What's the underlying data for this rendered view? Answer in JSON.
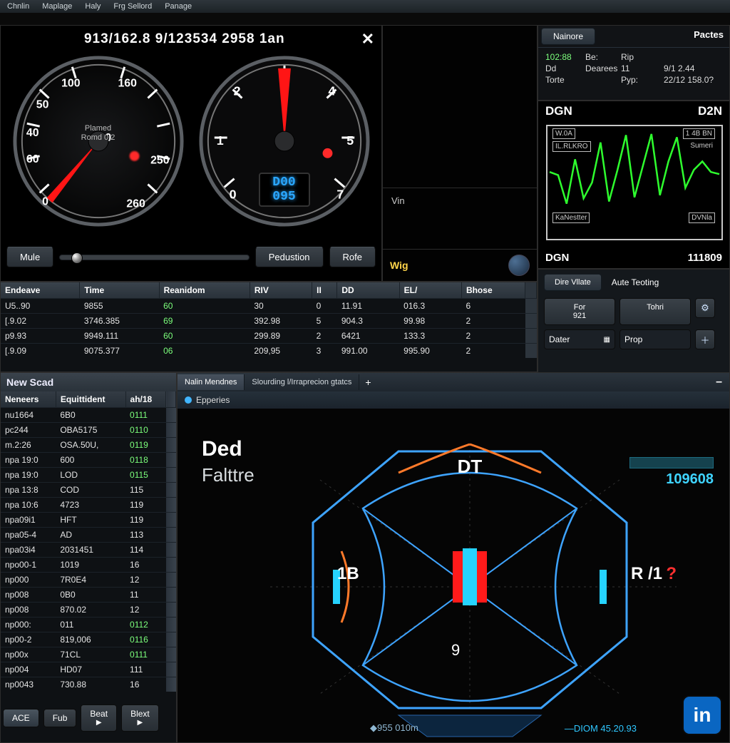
{
  "menu": [
    "Chnlin",
    "Maplage",
    "Haly",
    "Frg Sellord",
    "Panage"
  ],
  "dash": {
    "banner": "913/162.8 9/123534 2958 1an",
    "close": "✕",
    "gauge1": {
      "ticks": [
        "0",
        "40",
        "50",
        "60",
        "100",
        "100",
        "160",
        "250",
        "260"
      ],
      "sub1": "Plamed",
      "sub2": "Romd 0:2"
    },
    "gauge2": {
      "ticks": [
        "0",
        "1",
        "2",
        "3",
        "4",
        "5",
        "7"
      ],
      "sub1": "",
      "sub2": ""
    },
    "lcd": {
      "l1": "D00",
      "l2": "095"
    },
    "mule_label": "Mule",
    "ped_label": "Pedustion",
    "rofe_label": "Rofe"
  },
  "view": {
    "vin_label": "Vin",
    "wig_label": "Wig"
  },
  "info": {
    "tab": "Nainore",
    "paces": "Pactes",
    "rows": [
      [
        "102:88",
        "Be:",
        "Rip",
        ""
      ],
      [
        "Dd",
        "Dearees",
        "11",
        "9/1 2.44"
      ],
      [
        "Torte",
        "",
        "Pyp:",
        "22/12 158.0?"
      ]
    ]
  },
  "wave": {
    "hdr_l": "DGN",
    "hdr_r": "D2N",
    "box1": "W.0A",
    "box2": "1 4B BN",
    "box3": "IL.RLKRO",
    "box4": "Sumeri",
    "box5": "KaNestter",
    "box6": "DVNla",
    "ftr_l": "DGN",
    "ftr_r": "111809"
  },
  "chart_data": {
    "type": "line",
    "title": "DGN",
    "xlabel": "",
    "ylabel": "",
    "series": [
      {
        "name": "signal",
        "color": "#2eff2e",
        "x": [
          0,
          1,
          2,
          3,
          4,
          5,
          6,
          7,
          8,
          9,
          10,
          11,
          12,
          13,
          14,
          15,
          16,
          17,
          18,
          19,
          20
        ],
        "y": [
          60,
          57,
          30,
          72,
          35,
          50,
          88,
          32,
          62,
          95,
          36,
          66,
          96,
          38,
          70,
          93,
          45,
          62,
          70,
          60,
          58
        ]
      }
    ],
    "ylim": [
      0,
      100
    ]
  },
  "ctl": {
    "tab1": "Dire Vllate",
    "plain": "Aute Teoting",
    "for_lbl": "For",
    "for_val": "921",
    "tohr": "Tohri",
    "dater": "Dater",
    "prop": "Prop"
  },
  "data_table": {
    "headers": [
      "Endeave",
      "Time",
      "Reanidom",
      "RIV",
      "II",
      "DD",
      "EL/",
      "Bhose"
    ],
    "rows": [
      [
        "U5..90",
        "9855",
        "60",
        "30",
        "0",
        "11.91",
        "016.3",
        "6"
      ],
      [
        "[.9.02",
        "3746.385",
        "69",
        "392.98",
        "5",
        "904.3",
        "99.98",
        "2"
      ],
      [
        "p9.93",
        "9949.111",
        "60",
        "299.89",
        "2",
        "6421",
        "133.3",
        "2"
      ],
      [
        "[.9.09",
        "9075.377",
        "06",
        "209,95",
        "3",
        "991.00",
        "995.90",
        "2"
      ]
    ],
    "green_col": 2
  },
  "scad": {
    "title": "New Scad",
    "headers": [
      "Neneers",
      "Equittident",
      "ah/18"
    ],
    "rows": [
      [
        "nu1664",
        "6B0",
        "0111"
      ],
      [
        "pc244",
        "OBA5175",
        "0110"
      ],
      [
        "m.2:26",
        "OSA.50U,",
        "0119"
      ],
      [
        "npa 19:0",
        "600",
        "0118"
      ],
      [
        "npa 19:0",
        "LOD",
        "0115"
      ],
      [
        "npa 13:8",
        "COD",
        "115"
      ],
      [
        "npa 10:6",
        "4723",
        "119"
      ],
      [
        "npa09i1",
        "HFT",
        "119"
      ],
      [
        "npa05-4",
        "AD",
        "113"
      ],
      [
        "npa03i4",
        "2031451",
        "114"
      ],
      [
        "npo00-1",
        "1019",
        "16"
      ],
      [
        "np000",
        "7R0E4",
        "12"
      ],
      [
        "np008",
        "0B0",
        "11"
      ],
      [
        "np008",
        "870.02",
        "12"
      ],
      [
        "np000:",
        "011",
        "0112"
      ],
      [
        "np00-2",
        "819,006",
        "0116"
      ],
      [
        "np00x",
        "71CL",
        "0111"
      ],
      [
        "np004",
        "HD07",
        "111"
      ],
      [
        "np0043",
        "730.88",
        "16"
      ]
    ]
  },
  "diag": {
    "tab1": "Nalin Mendnes",
    "tab2": "Slourding l/Irraprecion gtatcs",
    "sub": "Epperies",
    "title": "Ded",
    "sub_t": "Falttre",
    "dt": "DT",
    "lb": "1B",
    "rb": "R /1",
    "rv": "?",
    "nine": "9",
    "counter": "109608",
    "btm_l": "◆955 010m",
    "btm_r": "—DIOM  45.20.93"
  },
  "bbar": {
    "ace": "ACE",
    "fub": "Fub",
    "beat": "Beat",
    "blext": "Blext"
  }
}
